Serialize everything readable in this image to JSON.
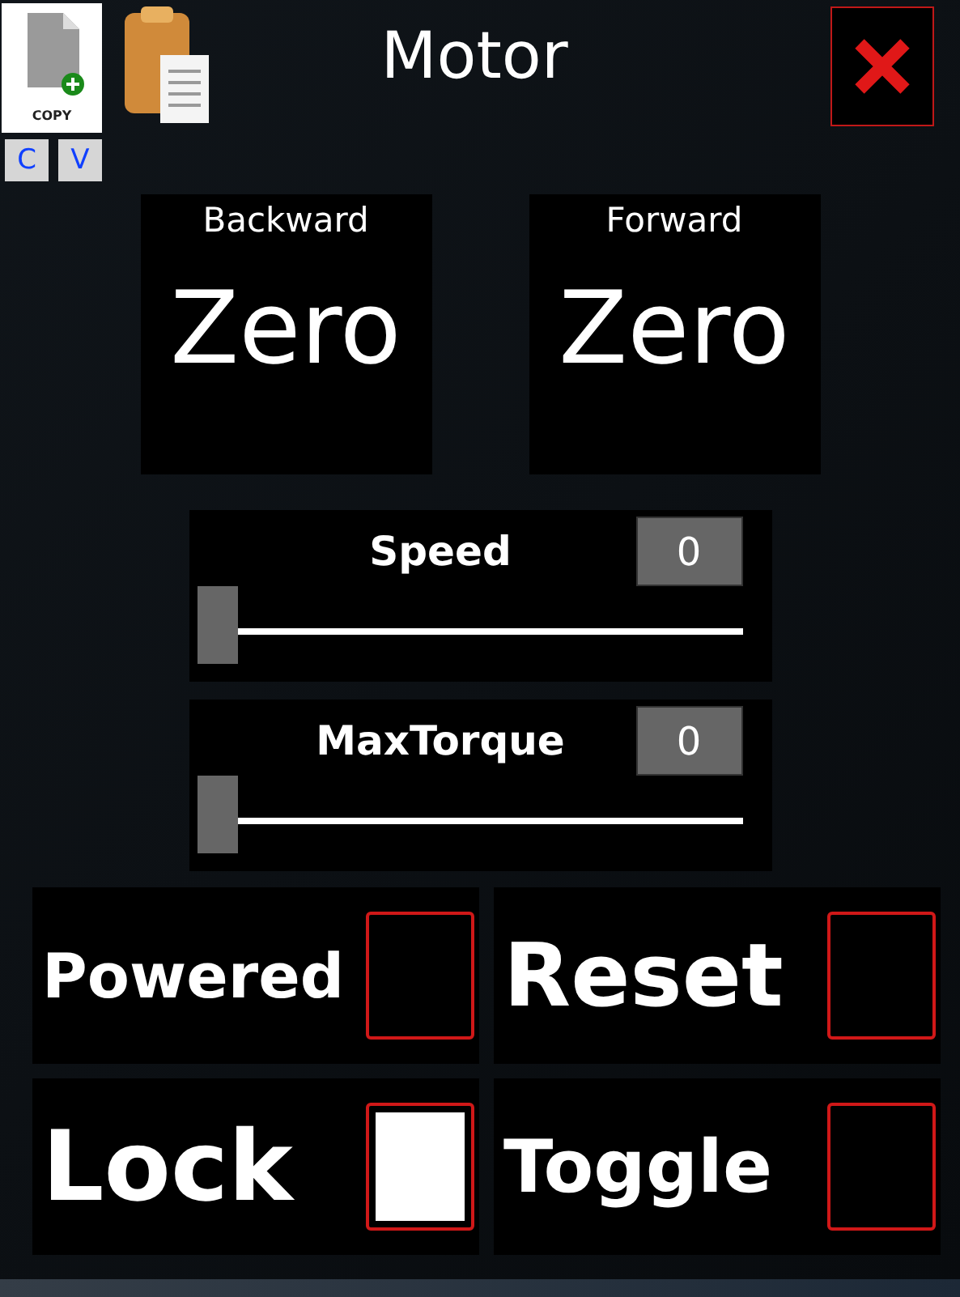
{
  "window": {
    "title": "Motor"
  },
  "toolbar": {
    "copy_icon_label": "COPY",
    "copy_key": "C",
    "paste_key": "V"
  },
  "direction_panels": [
    {
      "label": "Backward",
      "value": "Zero"
    },
    {
      "label": "Forward",
      "value": "Zero"
    }
  ],
  "sliders": [
    {
      "label": "Speed",
      "reading": "0",
      "level": 0
    },
    {
      "label": "MaxTorque",
      "reading": "0",
      "level": 0
    }
  ],
  "toggles": [
    {
      "label": "Powered",
      "checked": false
    },
    {
      "label": "Reset",
      "checked": false
    },
    {
      "label": "Lock",
      "checked": true
    },
    {
      "label": "Toggle",
      "checked": false
    }
  ]
}
